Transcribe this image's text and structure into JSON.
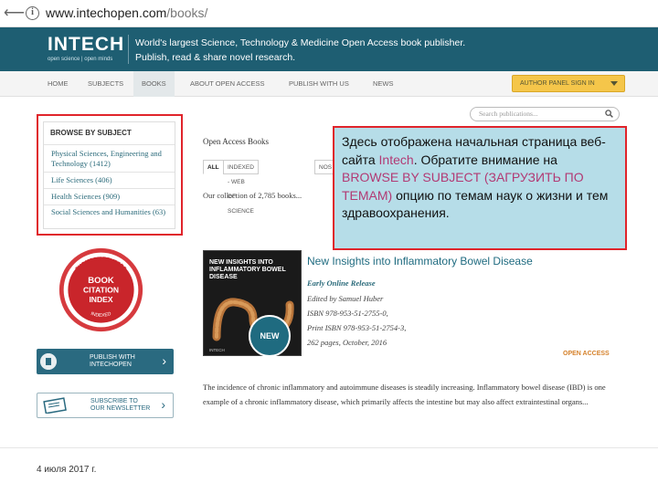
{
  "browser": {
    "url_host": "www.intechopen.com",
    "url_path": "/books/"
  },
  "header": {
    "logo": "INTECH",
    "logo_tagline": "open science | open minds",
    "tagline_line1": "World's largest Science, Technology & Medicine Open Access book publisher.",
    "tagline_line2": "Publish, read & share novel research."
  },
  "nav": {
    "items": [
      "HOME",
      "SUBJECTS",
      "BOOKS",
      "ABOUT OPEN ACCESS",
      "PUBLISH WITH US",
      "NEWS"
    ],
    "auth_label": "AUTHOR PANEL SIGN IN"
  },
  "search": {
    "placeholder": "Search publications..."
  },
  "browse": {
    "title": "BROWSE BY SUBJECT",
    "items": [
      "Physical Sciences, Engineering and Technology (1412)",
      "Life Sciences (406)",
      "Health Sciences (909)",
      "Social Sciences and Humanities (63)"
    ]
  },
  "badge": {
    "top": "THOMSON REUTERS",
    "line1": "BOOK",
    "line2": "CITATION",
    "line3": "INDEX",
    "bottom": "INDEXED"
  },
  "buttons": {
    "publish_line1": "PUBLISH WITH",
    "publish_line2": "INTECHOPEN",
    "subscribe_line1": "SUBSCRIBE TO",
    "subscribe_line2": "OUR NEWSLETTER"
  },
  "main": {
    "title": "Open Access Books",
    "tabs": [
      "ALL",
      "INDEXED - WEB OF SCIENCE",
      "NOS"
    ],
    "collection": "Our collection of 2,785 books..."
  },
  "book": {
    "cover_title": "NEW INSIGHTS INTO INFLAMMATORY BOWEL DISEASE",
    "cover_publisher": "INTECH",
    "new_label": "NEW",
    "title": "New Insights into Inflammatory Bowel Disease",
    "release": "Early Online Release",
    "editor": "Edited by Samuel Huber",
    "isbn": "ISBN 978-953-51-2755-0,",
    "print_isbn": "Print ISBN 978-953-51-2754-3,",
    "pages": "262 pages, October, 2016",
    "open_access": "OPEN ACCESS",
    "description": "The incidence of chronic inflammatory and autoimmune diseases is steadily increasing. Inflammatory bowel disease (IBD) is one example of a chronic inflammatory disease, which primarily affects the intestine but may also affect extraintestinal organs..."
  },
  "callout": {
    "part1": "Здесь отображена начальная страница веб-сайта ",
    "intech": "Intech",
    "part2": ". Обратите внимание на ",
    "browse": "BROWSE BY SUBJECT (ЗАГРУЗИТЬ ПО ТЕМАМ)",
    "part3": " опцию по темам наук о жизни и тем здравоохранения."
  },
  "footer": {
    "date": "4 июля 2017 г."
  },
  "colors": {
    "header_bg": "#1e5e72",
    "accent_red": "#e0242b",
    "callout_bg": "#b6dde8",
    "auth_yellow": "#f5c64a",
    "link_teal": "#2a6a7a"
  }
}
